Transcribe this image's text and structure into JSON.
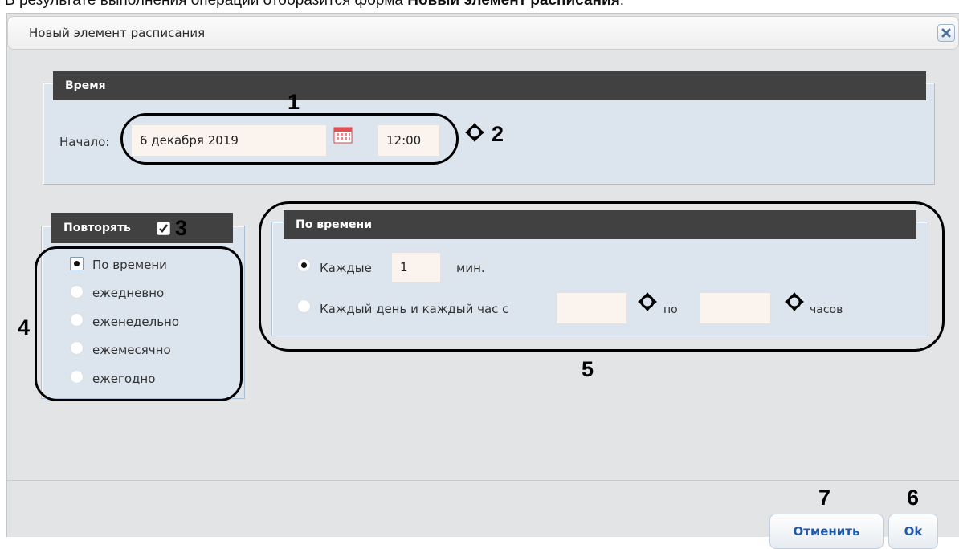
{
  "caption": {
    "prefix": "В результате выполнения операции отобразится форма ",
    "bold": "Новый элемент расписания",
    "suffix": "."
  },
  "dialog": {
    "title": "Новый элемент расписания"
  },
  "time_section": {
    "legend": "Время",
    "start_label": "Начало:",
    "date_value": "6 декабря 2019",
    "time_value": "12:00"
  },
  "repeat_section": {
    "legend": "Повторять",
    "checked": true,
    "options": [
      {
        "label": "По времени",
        "selected": true
      },
      {
        "label": "ежедневно",
        "selected": false
      },
      {
        "label": "еженедельно",
        "selected": false
      },
      {
        "label": "ежемесячно",
        "selected": false
      },
      {
        "label": "ежегодно",
        "selected": false
      }
    ]
  },
  "by_time_section": {
    "legend": "По времени",
    "every_label": "Каждые",
    "every_value": "1",
    "every_unit": "мин.",
    "daily_label": "Каждый день и каждый час с",
    "from_value": "",
    "to_label": "по",
    "to_value": "",
    "hours_label": "часов"
  },
  "buttons": {
    "cancel": "Отменить",
    "ok": "Ok"
  },
  "annotations": {
    "n1": "1",
    "n2": "2",
    "n3": "3",
    "n4": "4",
    "n5": "5",
    "n6": "6",
    "n7": "7"
  },
  "colors": {
    "panel_bg": "#dce4ee",
    "legend_bg": "#414141",
    "field_bg": "#fbf3ed",
    "button_text": "#205aa8"
  },
  "icons": [
    "close-icon",
    "calendar-icon",
    "move-arrows-icon"
  ]
}
